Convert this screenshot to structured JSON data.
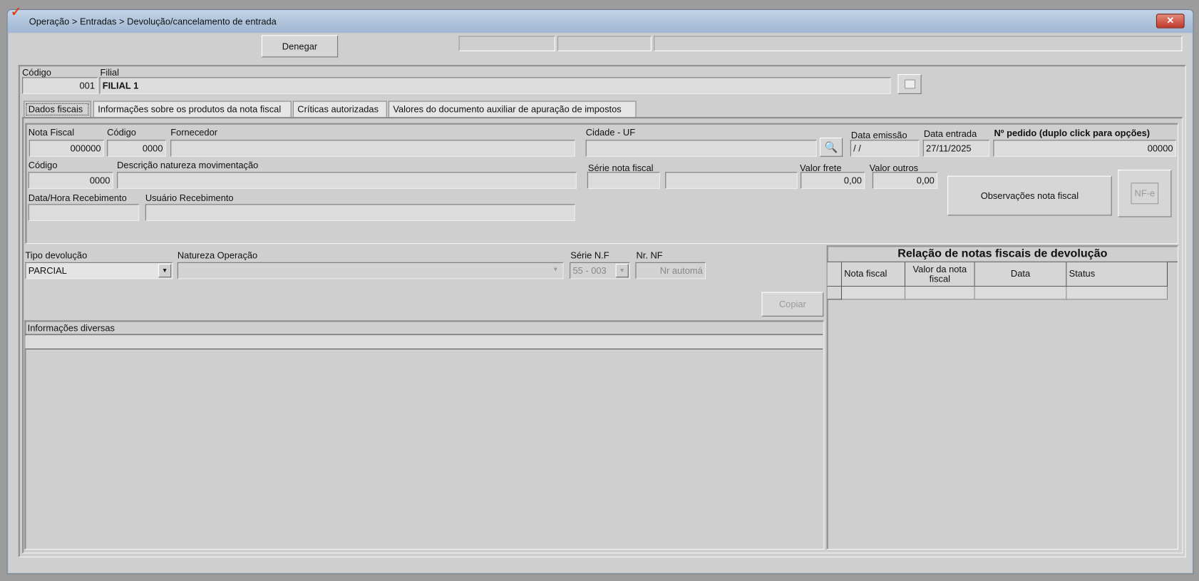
{
  "window": {
    "title": "Operação > Entradas > Devolução/cancelamento de entrada",
    "close": "✕"
  },
  "toolbar": {
    "denegar": "Denegar"
  },
  "filial": {
    "codigo_label": "Código",
    "codigo_value": "001",
    "filial_label": "Filial",
    "filial_value": "FILIAL 1"
  },
  "tabs": [
    "Dados fiscais",
    "Informações sobre os produtos da nota fiscal",
    "Críticas autorizadas",
    "Valores do documento auxiliar de apuração de impostos"
  ],
  "dados": {
    "nota_fiscal_label": "Nota Fiscal",
    "nota_fiscal": "000000",
    "codigo_forn_label": "Código",
    "codigo_forn": "0000",
    "fornecedor_label": "Fornecedor",
    "fornecedor": "",
    "cidade_label": "Cidade - UF",
    "cidade": "",
    "data_emissao_label": "Data emissão",
    "data_emissao": " / /",
    "data_entrada_label": "Data entrada",
    "data_entrada": "27/11/2025",
    "pedido_label": "Nº pedido (duplo click para opções)",
    "pedido": "00000",
    "codigo_nat_label": "Código",
    "codigo_nat": "0000",
    "descricao_label": "Descrição natureza movimentação",
    "descricao": "",
    "serie_label": "Série nota fiscal",
    "serie": "",
    "serie2": "",
    "frete_label": "Valor frete",
    "frete": "0,00",
    "outros_label": "Valor outros",
    "outros": "0,00",
    "receb_label": "Data/Hora Recebimento",
    "receb": "",
    "usuario_label": "Usuário Recebimento",
    "usuario": "",
    "observacoes": "Observações nota fiscal",
    "nfe": "NF-e"
  },
  "devolucao": {
    "tipo_label": "Tipo devolução",
    "tipo": "PARCIAL",
    "natureza_label": "Natureza  Operação",
    "natureza": "",
    "serie_label": "Série N.F",
    "serie": "55 - 003",
    "nr_label": "Nr. NF",
    "nr": "Nr automá",
    "copiar": "Copiar",
    "info_label": "Informações diversas"
  },
  "relacao": {
    "title": "Relação de notas fiscais de devolução",
    "columns": [
      "Nota fiscal",
      "Valor da nota fiscal",
      "Data",
      "Status"
    ]
  }
}
